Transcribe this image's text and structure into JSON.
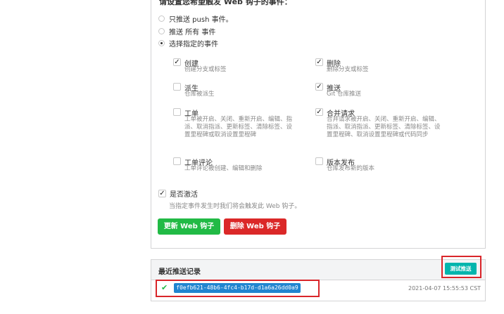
{
  "events_section": {
    "title": "请设置您希望触发 Web 钩子的事件："
  },
  "trigger_options": [
    {
      "label": "只推送 push 事件。",
      "checked": false
    },
    {
      "label": "推送 所有 事件",
      "checked": false
    },
    {
      "label": "选择指定的事件",
      "checked": true
    }
  ],
  "events": {
    "create": {
      "title": "创建",
      "desc": "创建分支或标签",
      "checked": true
    },
    "delete": {
      "title": "删除",
      "desc": "删除分支或标签",
      "checked": true
    },
    "fork": {
      "title": "派生",
      "desc": "仓库被派生",
      "checked": false
    },
    "push": {
      "title": "推送",
      "desc": "Git 仓库推送",
      "checked": true
    },
    "issues": {
      "title": "工单",
      "desc": "工单被开启、关闭、重新开启、编辑、指派、取消指派、更新标签、清除标签、设置里程碑或取消设置里程碑",
      "checked": false
    },
    "pull_request": {
      "title": "合并请求",
      "desc": "合并请求被开启、关闭、重新开启、编辑、指派、取消指派、更新标签、清除标签、设置里程碑、取消设置里程碑或代码同步",
      "checked": true
    },
    "issue_comment": {
      "title": "工单评论",
      "desc": "工单评论被创建、编辑和删除",
      "checked": false
    },
    "release": {
      "title": "版本发布",
      "desc": "仓库发布新的版本",
      "checked": false
    }
  },
  "active": {
    "label": "是否激活",
    "desc": "当指定事件发生时我们将会触发此 Web 钩子。",
    "checked": true
  },
  "buttons": {
    "update": "更新 Web 钩子",
    "delete": "删除 Web 钩子",
    "test": "测试推送"
  },
  "deliveries": {
    "title": "最近推送记录",
    "items": [
      {
        "uuid": "f0efb621-48b6-4fc4-b17d-d1a6a26dd0a9",
        "status": "✔",
        "timestamp": "2021-04-07 15:55:53 CST"
      }
    ]
  },
  "colors": {
    "green": "#21ba45",
    "red": "#db2828",
    "teal": "#00b5ad",
    "blue": "#2185d0",
    "highlight": "#d9252a"
  }
}
